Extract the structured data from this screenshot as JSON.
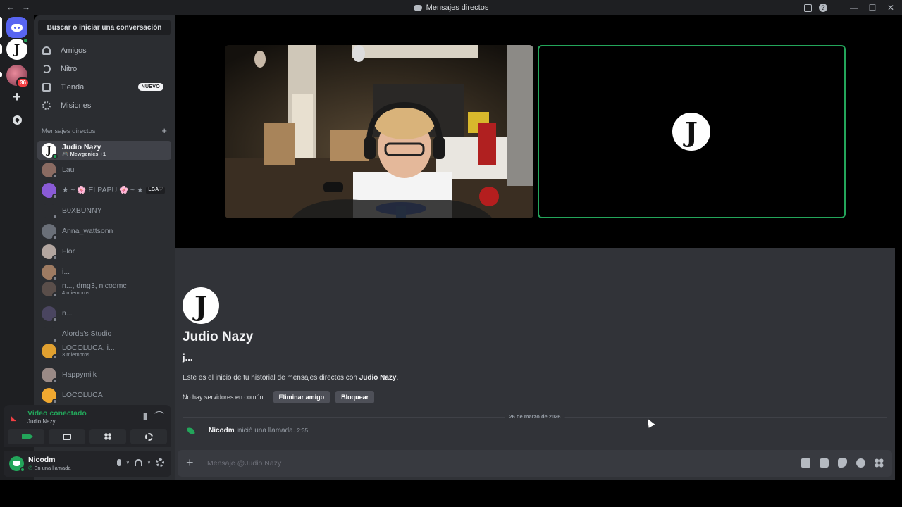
{
  "window": {
    "title": "Mensajes directos",
    "back": "←",
    "forward": "→",
    "minimize": "—",
    "maximize": "☐",
    "close": "✕",
    "help": "?"
  },
  "rail": {
    "server_badge": "36"
  },
  "sidebar": {
    "search_label": "Buscar o iniciar una conversación",
    "nav": [
      {
        "label": "Amigos"
      },
      {
        "label": "Nitro"
      },
      {
        "label": "Tienda",
        "badge": "NUEVO"
      },
      {
        "label": "Misiones"
      }
    ],
    "dm_header": "Mensajes directos",
    "dm_add": "+",
    "dms": [
      {
        "name": "Judio Nazy",
        "sub_icon": "🎮",
        "sub": "Mewgenics +1",
        "color": "#ffffff"
      },
      {
        "name": "Lau",
        "sub": "",
        "color": "#8a6b62"
      },
      {
        "name": "★ ~ 🌸 ELPAPU 🌸 ~ ★",
        "tag": "LGA♡",
        "sub": "",
        "color": "#8a5bd6"
      },
      {
        "name": "B0XBUNNY",
        "sub": "",
        "color": "#2b2d31"
      },
      {
        "name": "Anna_wattsonn",
        "sub": "",
        "color": "#6a6f78"
      },
      {
        "name": "Flor",
        "sub": "",
        "color": "#b3a6a0"
      },
      {
        "name": "i...",
        "sub": "",
        "color": "#9e7b62"
      },
      {
        "name": "n..., dmg3, nicodmc",
        "sub": "4 miembros",
        "color": "#5a4e4a"
      },
      {
        "name": "n...",
        "sub": "",
        "color": "#4a4560"
      },
      {
        "name": "Alorda's Studio",
        "sub": "",
        "color": "#2b2d31"
      },
      {
        "name": "LOCOLUCA, i...",
        "sub": "3 miembros",
        "color": "#e0a030"
      },
      {
        "name": "Happymilk",
        "sub": "",
        "color": "#9a8a86"
      },
      {
        "name": "LOCOLUCA",
        "sub": "",
        "color": "#f0a830"
      }
    ]
  },
  "voice": {
    "title": "Video conectado",
    "subtitle": "Judio Nazy"
  },
  "user": {
    "name": "Nicodm",
    "status": "En una llamada"
  },
  "main": {
    "intro_name": "Judio Nazy",
    "intro_username": "j...",
    "intro_desc_prefix": "Este es el inicio de tu historial de mensajes directos con ",
    "intro_desc_name": "Judio Nazy",
    "intro_desc_suffix": ".",
    "no_servers": "No hay servidores en común",
    "remove_friend": "Eliminar amigo",
    "block": "Bloquear",
    "date_divider": "26 de marzo de 2026",
    "call_user": "Nicodm",
    "call_text": "inició una llamada.",
    "call_duration": "2:35",
    "avatar_glyph": "J"
  },
  "composer": {
    "placeholder": "Mensaje @Judio Nazy",
    "add": "+"
  },
  "colors": {
    "accent": "#5865f2",
    "online": "#23a55a",
    "danger": "#f23f43"
  }
}
